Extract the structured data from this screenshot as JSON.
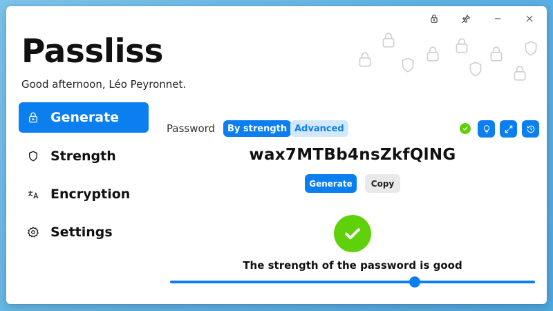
{
  "app": {
    "title": "Passliss",
    "greeting": "Good afternoon, Léo Peyronnet."
  },
  "titlebar": {
    "buttons": [
      {
        "name": "lock-window-button",
        "icon": "lock-icon"
      },
      {
        "name": "pin-button",
        "icon": "pin-icon"
      },
      {
        "name": "minimize-button",
        "icon": "minimize-icon"
      },
      {
        "name": "close-button",
        "icon": "close-icon"
      }
    ]
  },
  "sidebar": {
    "items": [
      {
        "label": "Generate",
        "icon": "lock-icon",
        "active": true
      },
      {
        "label": "Strength",
        "icon": "shield-icon",
        "active": false
      },
      {
        "label": "Encryption",
        "icon": "translate-icon",
        "active": false
      },
      {
        "label": "Settings",
        "icon": "gear-icon",
        "active": false
      }
    ]
  },
  "main": {
    "password_label": "Password",
    "mode_tabs": [
      {
        "label": "By strength",
        "selected": true
      },
      {
        "label": "Advanced",
        "selected": false
      }
    ],
    "toolbar_icons": [
      "lightbulb-icon",
      "expand-icon",
      "history-icon"
    ],
    "password_value": "wax7MTBb4nsZkfQlNG",
    "generate_label": "Generate",
    "copy_label": "Copy",
    "strength_text": "The strength of the password is good",
    "strength_slider_value": 0.67
  },
  "colors": {
    "accent": "#0b7ff0",
    "accent_light": "#d4e8fc",
    "good": "#5fd10a",
    "background": "#5fb2e4"
  }
}
